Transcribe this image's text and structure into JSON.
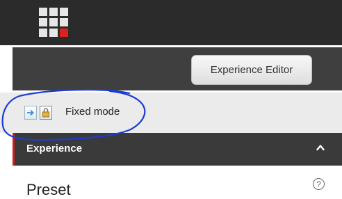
{
  "header": {
    "logo_icon": "grid-app-logo-icon",
    "accent_color": "#e21f1f"
  },
  "toolbar": {
    "experience_editor_label": "Experience Editor"
  },
  "mode": {
    "label": "Fixed mode",
    "icons": [
      "arrow-right-icon",
      "lock-icon"
    ]
  },
  "section": {
    "title": "Experience",
    "expanded": true,
    "accent_color": "#cf1f1f"
  },
  "preset": {
    "label": "Preset",
    "help_icon": "?"
  },
  "annotation": {
    "color": "#1a3cd6"
  }
}
